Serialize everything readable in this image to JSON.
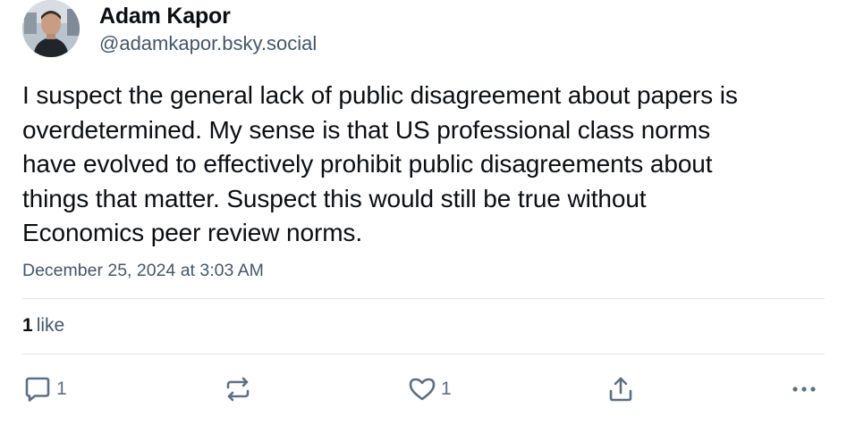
{
  "author": {
    "display_name": "Adam Kapor",
    "handle": "@adamkapor.bsky.social"
  },
  "post": {
    "text": "I suspect the general lack of public disagreement about papers is\noverdetermined. My sense is that US professional class norms\nhave evolved to effectively prohibit public disagreements about\nthings that matter. Suspect this would still be true without\nEconomics peer review norms.",
    "timestamp": "December 25, 2024 at 3:03 AM"
  },
  "stats": {
    "like_count": "1",
    "like_label": "like"
  },
  "actions": {
    "reply_count": "1",
    "like_count": "1",
    "icons": [
      "reply-icon",
      "repost-icon",
      "like-heart-icon",
      "share-icon",
      "more-options-icon"
    ]
  },
  "colors": {
    "text_primary": "#0b0f14",
    "text_secondary": "#42576c",
    "icon_gray": "#5b7087",
    "divider": "#dfe4ea"
  }
}
